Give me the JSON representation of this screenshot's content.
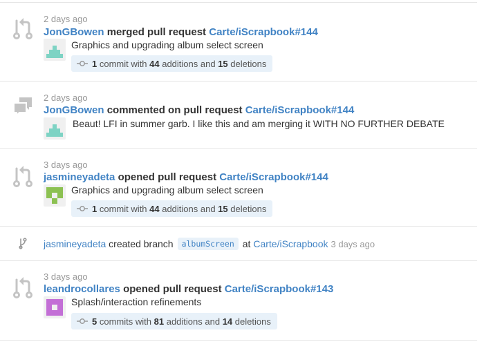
{
  "feed": [
    {
      "type": "merged",
      "icon": "git-pull-request-icon",
      "time": "2 days ago",
      "actor": "JonGBowen",
      "action": "merged pull request",
      "target": "Carte/iScrapbook#144",
      "message": "Graphics and upgrading album select screen",
      "commit_count": "1",
      "commit_word": "commit",
      "additions": "44",
      "deletions": "15"
    },
    {
      "type": "comment",
      "icon": "comment-icon",
      "time": "2 days ago",
      "actor": "JonGBowen",
      "action": "commented on pull request",
      "target": "Carte/iScrapbook#144",
      "message": "Beaut! LFI in summer garb. I like this and am merging it WITH NO FURTHER DEBATE"
    },
    {
      "type": "opened",
      "icon": "git-pull-request-icon",
      "time": "3 days ago",
      "actor": "jasmineyadeta",
      "action": "opened pull request",
      "target": "Carte/iScrapbook#144",
      "message": "Graphics and upgrading album select screen",
      "commit_count": "1",
      "commit_word": "commit",
      "additions": "44",
      "deletions": "15"
    },
    {
      "type": "branch",
      "icon": "git-branch-icon",
      "actor": "jasmineyadeta",
      "action": "created branch",
      "branch": "albumScreen",
      "at": "at",
      "repo": "Carte/iScrapbook",
      "time": "3 days ago"
    },
    {
      "type": "opened",
      "icon": "git-pull-request-icon",
      "time": "3 days ago",
      "actor": "leandrocollares",
      "action": "opened pull request",
      "target": "Carte/iScrapbook#143",
      "message": "Splash/interaction refinements",
      "commit_count": "5",
      "commit_word": "commits",
      "additions": "81",
      "deletions": "14"
    }
  ],
  "labels": {
    "with": "with",
    "additions": "additions and",
    "deletions": "deletions"
  },
  "colors": {
    "link": "#4183c4",
    "muted": "#999999",
    "commit_bg": "#e8f1f9",
    "teal_avatar": "#7ed3c4",
    "green_avatar": "#8cc152",
    "purple_avatar": "#c36fd6"
  }
}
